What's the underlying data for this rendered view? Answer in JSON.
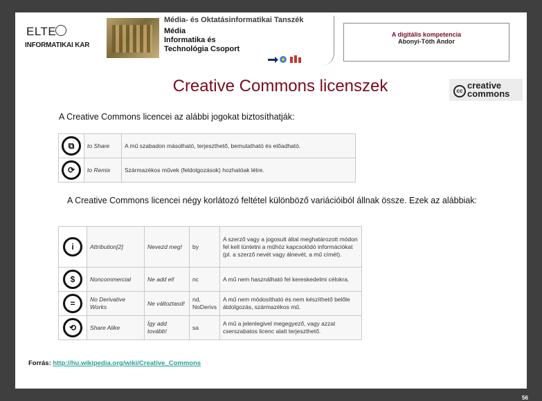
{
  "header": {
    "brand": {
      "name": "ELTE",
      "faculty": "INFORMATIKAI KAR"
    },
    "department": {
      "line1": "Média- és Oktatásinformatikai Tanszék",
      "line2": "Média\nInformatika és\nTechnológia Csoport"
    },
    "course": {
      "title": "A digitális kompetencia",
      "author": "Abonyi-Tóth Andor"
    }
  },
  "slide": {
    "title": "Creative Commons licenszek",
    "cc_logo": {
      "symbol": "cc",
      "text": "creative\ncommons"
    },
    "intro1": "A Creative Commons licencei az alábbi jogokat biztosíthatják:",
    "rights": [
      {
        "icon": "share-icon",
        "glyph": "⧉",
        "name": "to Share",
        "description": "A mű szabadon másolható, terjeszthető, bemutatható és előadható."
      },
      {
        "icon": "remix-icon",
        "glyph": "⟳",
        "name": "to Remix",
        "description": "Származékos művek (feldolgozások) hozhatóak létre."
      }
    ],
    "intro2": "A Creative Commons licencei négy korlátozó feltétel különböző variációiból állnak össze. Ezek az alábbiak:",
    "conditions": [
      {
        "icon": "attribution-icon",
        "glyph": "i",
        "en": "Attribution[2]",
        "hu": "Nevezd meg!",
        "abbr": "by",
        "description": "A szerző vagy a jogosult által meghatározott módon fel kell tüntetni a műhöz kapcsolódó információkat (pl. a szerző nevét vagy álnevét, a mű címét)."
      },
      {
        "icon": "noncommercial-icon",
        "glyph": "$",
        "en": "Noncommercial",
        "hu": "Ne add el!",
        "abbr": "nc",
        "description": "A mű nem használható fel kereskedelmi célokra."
      },
      {
        "icon": "no-derivative-icon",
        "glyph": "=",
        "en": "No Derivative Works",
        "hu": "Ne változtasd!",
        "abbr": "nd, NoDerivs",
        "description": "A mű nem módosítható és nem készíthető belőle átdolgozás, származékos mű."
      },
      {
        "icon": "share-alike-icon",
        "glyph": "⟲",
        "en": "Share Alike",
        "hu": "Így add tovább!",
        "abbr": "sa",
        "description": "A mű a jelenlegivel megegyező, vagy azzal cserszabatos licenc alatt terjeszthető."
      }
    ],
    "source_label": "Forrás:",
    "source_link": "http://hu.wikipedia.org/wiki/Creative_Commons",
    "page_number": "56"
  },
  "colors": {
    "title": "#7a0b1f",
    "link": "#2aa198",
    "background": "#3f3f3f"
  }
}
